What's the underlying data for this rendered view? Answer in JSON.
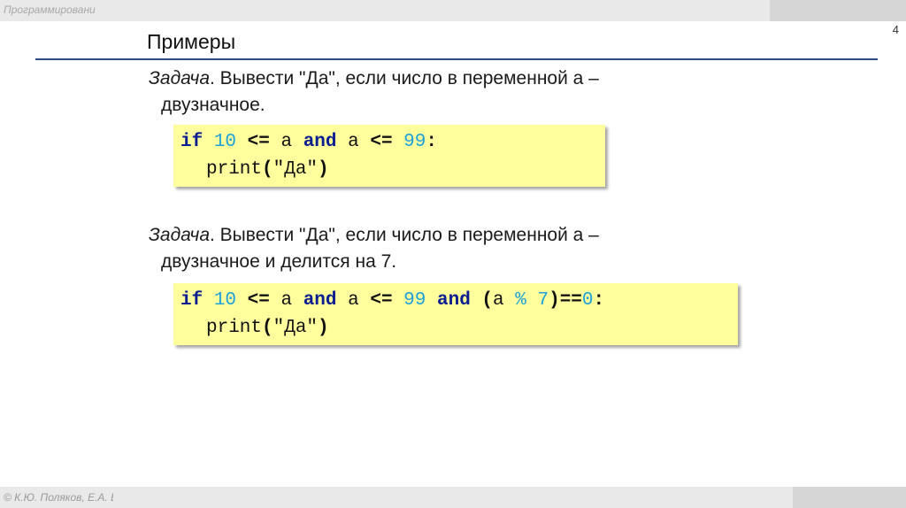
{
  "header": {
    "course_title": "Программировани",
    "slide_number": "4"
  },
  "title": "Примеры",
  "tasks": [
    {
      "label": "Задача",
      "text": ". Вывести \"Да\", если число в переменной a –",
      "continuation": "двузначное.",
      "code": {
        "l1": {
          "kw_if": "if",
          "n1": "10",
          "op1": "<=",
          "v1": "a",
          "kw_and": "and",
          "v2": "a",
          "op2": "<=",
          "n2": "99",
          "colon": ":"
        },
        "l2": {
          "fn": "print",
          "open": "(",
          "str": "\"Да\"",
          "close": ")"
        }
      }
    },
    {
      "label": "Задача",
      "text": ". Вывести \"Да\", если число в переменной a –",
      "continuation": "двузначное и делится на 7.",
      "code": {
        "l1": {
          "kw_if": "if",
          "n1": "10",
          "op1": "<=",
          "v1": "a",
          "kw_and": "and",
          "v2": "a",
          "op2": "<=",
          "n2": "99",
          "kw_and2": "and",
          "paren_open": "(",
          "v3": "a",
          "mod": "%",
          "n3": "7",
          "paren_close": ")",
          "eq": "==",
          "n4": "0",
          "colon": ":"
        },
        "l2": {
          "fn": "print",
          "open": "(",
          "str": "\"Да\"",
          "close": ")"
        }
      }
    }
  ],
  "footer": {
    "author": "© К.Ю. Поляков, Е.А. Ерёмин"
  },
  "colors": {
    "keyword": "#0b1d8f",
    "number": "#1fa0d6",
    "code_background": "#ffff9e",
    "title_rule": "#2f4b8a"
  }
}
